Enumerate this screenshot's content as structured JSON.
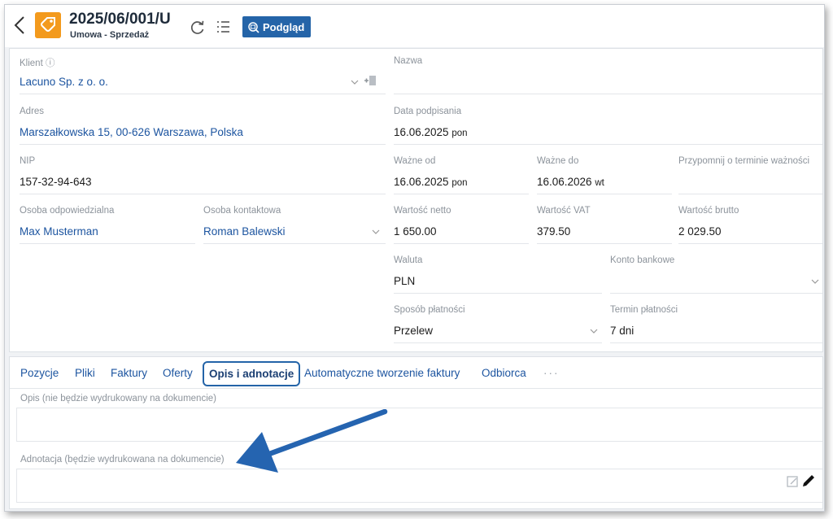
{
  "header": {
    "doc_number": "2025/06/001/U",
    "doc_type": "Umowa - Sprzedaż",
    "preview_label": "Podgląd"
  },
  "fields": {
    "klient": {
      "label": "Klient ⓘ",
      "value": "Lacuno Sp. z o. o."
    },
    "nazwa": {
      "label": "Nazwa",
      "value": ""
    },
    "adres": {
      "label": "Adres",
      "value": "Marszałkowska 15, 00-626 Warszawa, Polska"
    },
    "data_podpisania": {
      "label": "Data podpisania",
      "value": "16.06.2025",
      "weekday": "pon"
    },
    "nip": {
      "label": "NIP",
      "value": "157-32-94-643"
    },
    "wazne_od": {
      "label": "Ważne od",
      "value": "16.06.2025",
      "weekday": "pon"
    },
    "wazne_do": {
      "label": "Ważne do",
      "value": "16.06.2026",
      "weekday": "wt"
    },
    "przypomnij": {
      "label": "Przypomnij o terminie ważności",
      "value": ""
    },
    "osoba_odpowiedzialna": {
      "label": "Osoba odpowiedzialna",
      "value": "Max Musterman"
    },
    "osoba_kontaktowa": {
      "label": "Osoba kontaktowa",
      "value": "Roman Balewski"
    },
    "wartosc_netto": {
      "label": "Wartość netto",
      "value": "1 650.00"
    },
    "wartosc_vat": {
      "label": "Wartość VAT",
      "value": "379.50"
    },
    "wartosc_brutto": {
      "label": "Wartość brutto",
      "value": "2 029.50"
    },
    "waluta": {
      "label": "Waluta",
      "value": "PLN"
    },
    "konto_bankowe": {
      "label": "Konto bankowe",
      "value": ""
    },
    "sposob_platnosci": {
      "label": "Sposób płatności",
      "value": "Przelew"
    },
    "termin_platnosci": {
      "label": "Termin płatności",
      "value": "7 dni"
    }
  },
  "tabs": [
    {
      "label": "Pozycje"
    },
    {
      "label": "Pliki"
    },
    {
      "label": "Faktury"
    },
    {
      "label": "Oferty"
    },
    {
      "label": "Opis i adnotacje",
      "active": true
    },
    {
      "label": "Automatyczne tworzenie faktury"
    },
    {
      "label": "Odbiorca"
    },
    {
      "label": "···"
    }
  ],
  "notes": {
    "opis_label": "Opis (nie będzie wydrukowany na dokumencie)",
    "opis_value": "",
    "adnotacja_label": "Adnotacja (będzie wydrukowana na dokumencie)",
    "adnotacja_value": ""
  },
  "icons": {
    "back": "chevron-left-icon",
    "doc": "price-tag-icon",
    "refresh": "refresh-icon",
    "list": "list-icon",
    "preview": "magnifier-icon",
    "add_client": "add-document-icon",
    "edit": "pencil-icon",
    "annotation_arrow": "arrow-icon"
  },
  "colors": {
    "accent": "#2464a8",
    "link": "#1d55a0",
    "doc_icon": "#f39a1d",
    "arrow": "#2564b0"
  }
}
